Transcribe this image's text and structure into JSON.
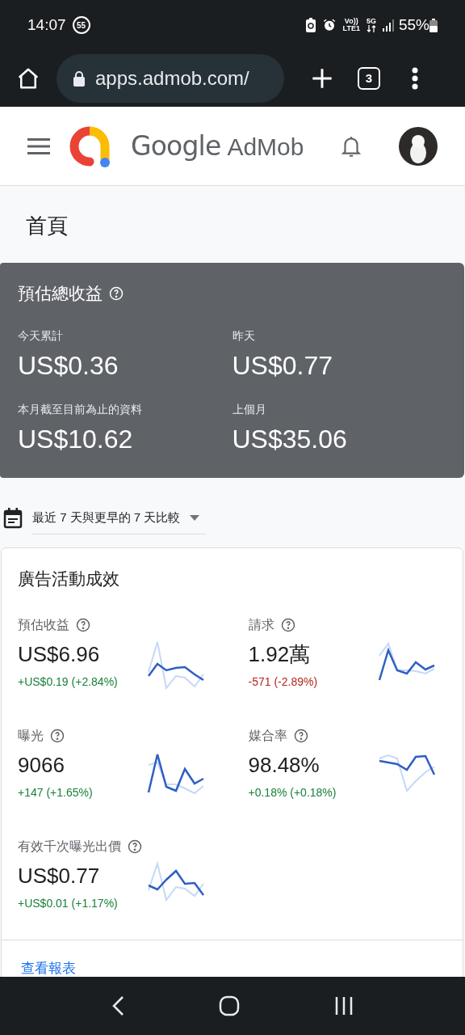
{
  "status_bar": {
    "time": "14:07",
    "badge": "55",
    "volte_top": "Vo))",
    "volte_bottom": "LTE1",
    "network": "5G",
    "battery": "55%"
  },
  "browser": {
    "url": "apps.admob.com/",
    "tab_count": "3"
  },
  "header": {
    "brand_google": "Google",
    "brand_product": "AdMob"
  },
  "page_title": "首頁",
  "earnings": {
    "title": "預估總收益",
    "items": [
      {
        "label": "今天累計",
        "value": "US$0.36"
      },
      {
        "label": "昨天",
        "value": "US$0.77"
      },
      {
        "label": "本月截至目前為止的資料",
        "value": "US$10.62"
      },
      {
        "label": "上個月",
        "value": "US$35.06"
      }
    ]
  },
  "date_range": "最近 7 天與更早的 7 天比較",
  "performance": {
    "title": "廣告活動成效",
    "metrics": [
      {
        "label": "預估收益",
        "value": "US$6.96",
        "change": "+US$0.19 (+2.84%)",
        "color": "#188038"
      },
      {
        "label": "請求",
        "value": "1.92萬",
        "change": "-571 (-2.89%)",
        "color": "#b3261e"
      },
      {
        "label": "曝光",
        "value": "9066",
        "change": "+147 (+1.65%)",
        "color": "#188038"
      },
      {
        "label": "媒合率",
        "value": "98.48%",
        "change": "+0.18% (+0.18%)",
        "color": "#188038"
      },
      {
        "label": "有效千次曝光出價",
        "value": "US$0.77",
        "change": "+US$0.01 (+1.17%)",
        "color": "#188038"
      }
    ],
    "link": "查看報表"
  }
}
